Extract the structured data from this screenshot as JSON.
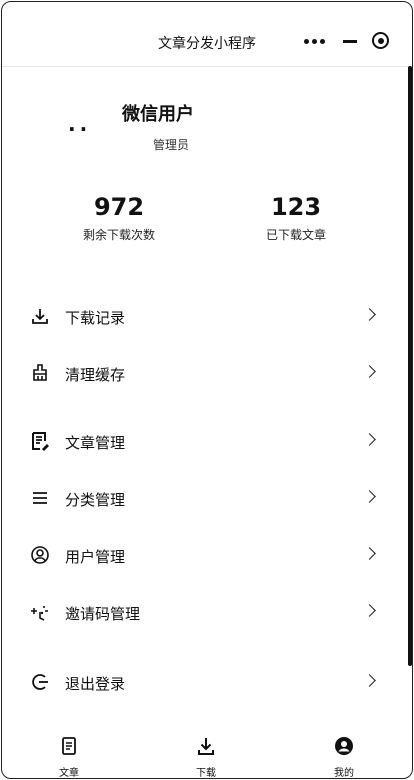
{
  "app": {
    "title": "文章分发小程序"
  },
  "profile": {
    "avatar": "..",
    "username": "微信用户",
    "role": "管理员"
  },
  "stats": [
    {
      "value": "972",
      "label": "剩余下载次数"
    },
    {
      "value": "123",
      "label": "已下载文章"
    }
  ],
  "menu": {
    "download_records": "下载记录",
    "clear_cache": "清理缓存",
    "article_manage": "文章管理",
    "category_manage": "分类管理",
    "user_manage": "用户管理",
    "invite_manage": "邀请码管理",
    "logout": "退出登录"
  },
  "tabs": [
    {
      "label": "文章",
      "icon": "document-icon"
    },
    {
      "label": "下载",
      "icon": "download-icon"
    },
    {
      "label": "我的",
      "icon": "user-circle-icon"
    }
  ]
}
